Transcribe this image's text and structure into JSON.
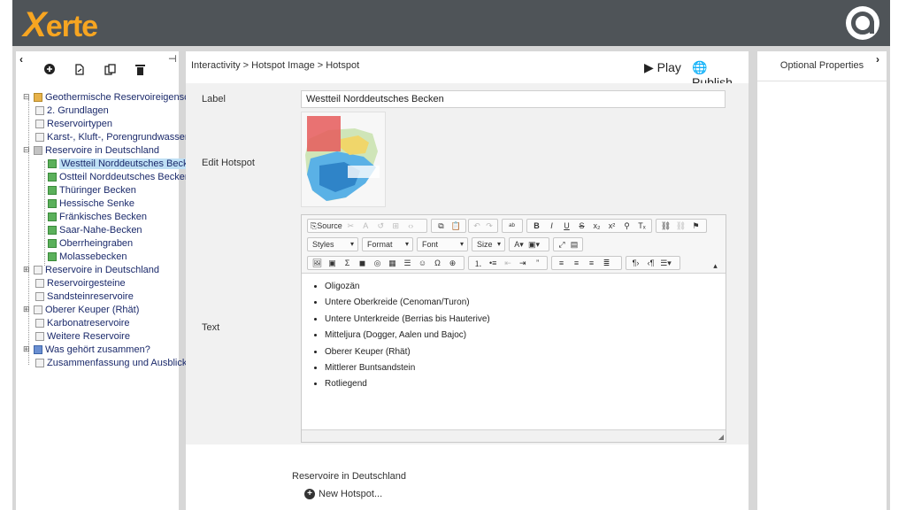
{
  "app": {
    "logo_text": "erte",
    "logo_x": "X"
  },
  "tree": {
    "root": "Geothermische Reservoireigenschaften",
    "items": [
      "2. Grundlagen",
      "Reservoirtypen",
      "Karst-, Kluft-, Porengrundwasserleiter",
      "Reservoire in Deutschland",
      "Westteil Norddeutsches Becken",
      "Ostteil Norddeutsches Becken",
      "Thüringer Becken",
      "Hessische Senke",
      "Fränkisches Becken",
      "Saar-Nahe-Becken",
      "Oberrheingraben",
      "Molassebecken",
      "Reservoire in Deutschland",
      "Reservoirgesteine",
      "Sandsteinreservoire",
      "Oberer Keuper (Rhät)",
      "Karbonatreservoire",
      "Weitere Reservoire",
      "Was gehört zusammen?",
      "Zusammenfassung und Ausblick"
    ]
  },
  "header": {
    "breadcrumb": "Interactivity > Hotspot Image > Hotspot",
    "play_label": "Play",
    "publish_label": "Publish"
  },
  "form": {
    "label_field_label": "Label",
    "label_value": "Westteil Norddeutsches Becken",
    "edit_hotspot_label": "Edit Hotspot",
    "text_label": "Text"
  },
  "editor": {
    "source_label": "Source",
    "styles_label": "Styles",
    "format_label": "Format",
    "font_label": "Font",
    "size_label": "Size",
    "bullets": [
      "Oligozän",
      "Untere Oberkreide (Cenoman/Turon)",
      "Untere Unterkreide (Berrias bis Hauterive)",
      "Mitteljura (Dogger, Aalen und Bajoc)",
      "Oberer Keuper (Rhät)",
      "Mittlerer Buntsandstein",
      "Rotliegend"
    ]
  },
  "footer": {
    "section_label": "Reservoire in Deutschland",
    "new_hotspot_label": "New Hotspot..."
  },
  "right_panel": {
    "title": "Optional Properties"
  },
  "colors": {
    "topbar": "#4f5458",
    "logo": "#f7a521",
    "workarea": "#d7d7d7",
    "selected": "#bfe0f5"
  }
}
